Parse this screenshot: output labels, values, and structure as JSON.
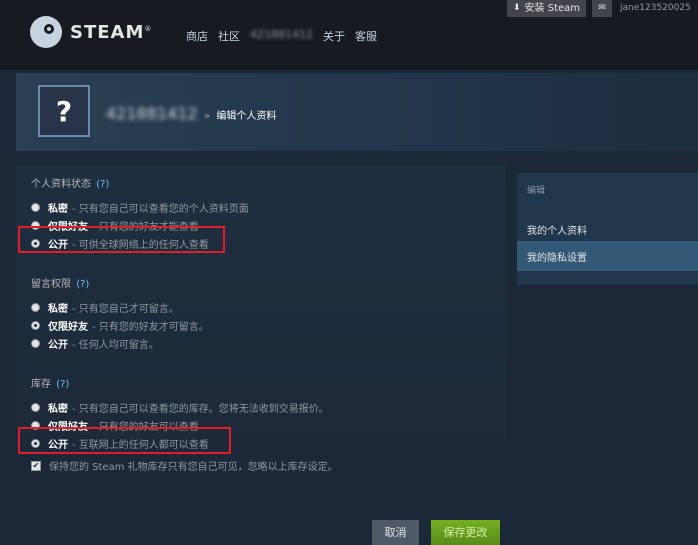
{
  "header": {
    "brand": "STEAM",
    "brand_tm": "®",
    "nav": [
      "商店",
      "社区",
      "421881412",
      "关于",
      "客服"
    ],
    "install_label": "安装 Steam",
    "account_name": "jane123520025"
  },
  "profile": {
    "avatar_glyph": "?",
    "persona_name": "421881412",
    "separator": "»",
    "page_title": "编辑个人资料"
  },
  "sections": {
    "profile_state": {
      "title": "个人资料状态",
      "help": "(?)",
      "options": [
        {
          "label": "私密",
          "desc": "- 只有您自己可以查看您的个人资料页面",
          "selected": false
        },
        {
          "label": "仅限好友",
          "desc": "- 只有您的好友才能查看",
          "selected": false
        },
        {
          "label": "公开",
          "desc": "- 可供全球网络上的任何人查看",
          "selected": true
        }
      ]
    },
    "comments": {
      "title": "留言权限",
      "help": "(?)",
      "options": [
        {
          "label": "私密",
          "desc": "- 只有您自己才可留言。",
          "selected": false
        },
        {
          "label": "仅限好友",
          "desc": "- 只有您的好友才可留言。",
          "selected": true
        },
        {
          "label": "公开",
          "desc": "- 任何人均可留言。",
          "selected": false
        }
      ]
    },
    "inventory": {
      "title": "库存",
      "help": "(?)",
      "options": [
        {
          "label": "私密",
          "desc": "- 只有您自己可以查看您的库存。您将无法收到交易报价。",
          "selected": false
        },
        {
          "label": "仅限好友",
          "desc": "- 只有您的好友可以查看",
          "selected": false
        },
        {
          "label": "公开",
          "desc": "- 互联网上的任何人都可以查看",
          "selected": true
        }
      ]
    }
  },
  "gift_checkbox": {
    "label": "保持您的 Steam 礼物库存只有您自己可见，忽略以上库存设定。",
    "checked": true,
    "mark": "✔"
  },
  "sidebar": {
    "heading": "编辑",
    "items": [
      "我的个人资料",
      "我的隐私设置"
    ],
    "active_index": 1
  },
  "buttons": {
    "cancel": "取消",
    "save": "保存更改"
  },
  "colors": {
    "background": "#1b2838",
    "highlight_box": "#e21d23",
    "save_green": "#75b022",
    "link_blue": "#66c0f4"
  }
}
